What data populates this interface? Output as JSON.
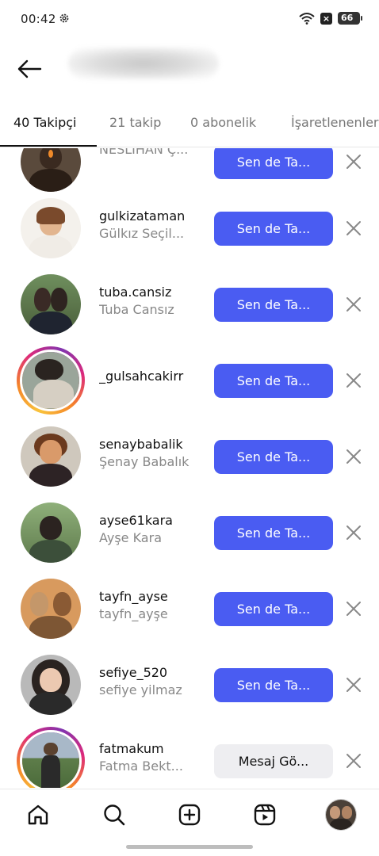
{
  "status_bar": {
    "time": "00:42",
    "battery": "66",
    "icons": [
      "gear-icon",
      "wifi-icon",
      "sim-x-icon",
      "battery-icon"
    ]
  },
  "header": {
    "back_icon": "arrow-left-icon"
  },
  "tabs": [
    {
      "label": "40 Takipçi",
      "active": true
    },
    {
      "label": "21 takip",
      "active": false
    },
    {
      "label": "0 abonelik",
      "active": false
    },
    {
      "label": "İşaretlenenler",
      "active": false
    }
  ],
  "followers": [
    {
      "username": "",
      "full_name": "NESLIHAN Ç...",
      "button": "Sen de Ta...",
      "button_type": "follow",
      "story": false,
      "colors": {
        "bg": "#5a4a3c",
        "head": "#3a2a20",
        "body": "#2a1e16"
      }
    },
    {
      "username": "gulkizataman",
      "full_name": "Gülkız Seçil...",
      "button": "Sen de Ta...",
      "button_type": "follow",
      "story": false,
      "colors": {
        "bg": "#f4f1ec",
        "head": "#e2b58f",
        "body": "#7a4a2c"
      }
    },
    {
      "username": "tuba.cansiz",
      "full_name": "Tuba Cansız",
      "button": "Sen de Ta...",
      "button_type": "follow",
      "story": false,
      "colors": {
        "bg": "#5f7a4e",
        "head": "#3a2a26",
        "body": "#1f2430"
      }
    },
    {
      "username": "_gulsahcakirr",
      "full_name": "",
      "button": "Sen de Ta...",
      "button_type": "follow",
      "story": true,
      "colors": {
        "bg": "#9aa59a",
        "head": "#2a2420",
        "body": "#c7c2b8"
      }
    },
    {
      "username": "senaybabalik",
      "full_name": "Şenay Babalık",
      "button": "Sen de Ta...",
      "button_type": "follow",
      "story": false,
      "colors": {
        "bg": "#cfc8bd",
        "head": "#c58b5a",
        "body": "#2d2325"
      }
    },
    {
      "username": "ayse61kara",
      "full_name": "Ayşe Kara",
      "button": "Sen de Ta...",
      "button_type": "follow",
      "story": false,
      "colors": {
        "bg": "#6f8f5a",
        "head": "#2b2320",
        "body": "#3c4f3a"
      }
    },
    {
      "username": "tayfn_ayse",
      "full_name": "tayfn_ayşe",
      "button": "Sen de Ta...",
      "button_type": "follow",
      "story": false,
      "colors": {
        "bg": "#d89a5e",
        "head": "#c4976a",
        "body": "#7d5634"
      }
    },
    {
      "username": "sefiye_520",
      "full_name": "sefiye yilmaz",
      "button": "Sen de Ta...",
      "button_type": "follow",
      "story": false,
      "colors": {
        "bg": "#b9b9b9",
        "head": "#e6c4ad",
        "body": "#2a2a2a"
      }
    },
    {
      "username": "fatmakum",
      "full_name": "Fatma Bekt...",
      "button": "Mesaj Gö...",
      "button_type": "message",
      "story": true,
      "colors": {
        "bg": "#a8b8c8",
        "head": "#5a4230",
        "body": "#2a2a2a"
      }
    }
  ],
  "remove_icon": "close-icon",
  "bottom_nav": [
    {
      "icon": "home-icon"
    },
    {
      "icon": "search-icon"
    },
    {
      "icon": "create-icon"
    },
    {
      "icon": "reels-icon"
    },
    {
      "icon": "profile-avatar"
    }
  ]
}
